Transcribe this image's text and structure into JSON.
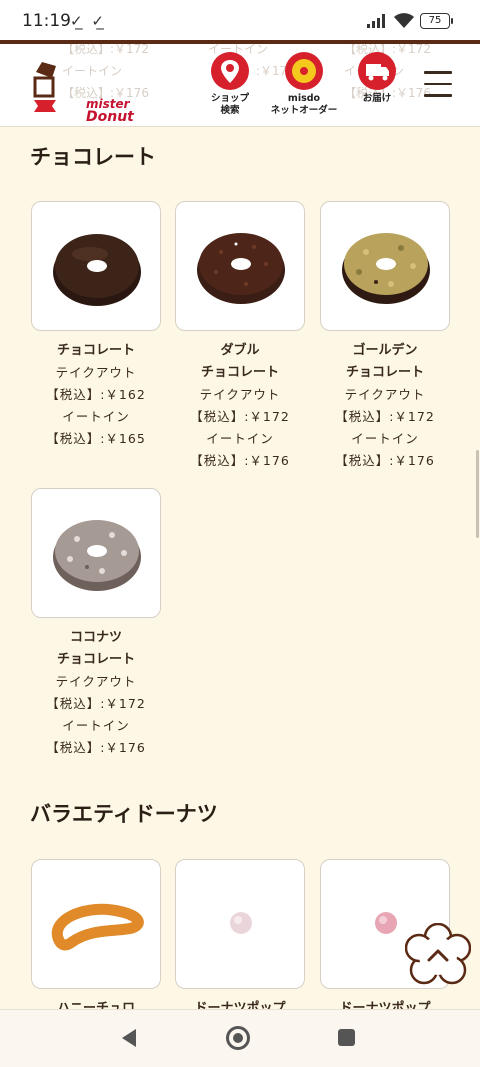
{
  "status_bar": {
    "time": "11:19",
    "check_marks": "✓̲ ✓̲",
    "battery": "75"
  },
  "header": {
    "logo_text": [
      "mister",
      "Donut"
    ],
    "ghost_left": [
      "【税込】:￥172",
      "イートイン",
      "【税込】:￥176"
    ],
    "ghost_mid": [
      "イートイン",
      "【税込】:￥176"
    ],
    "ghost_right": [
      "【税込】:￥172",
      "イートイン",
      "【税込】:￥176"
    ],
    "nav": [
      {
        "label": "ショップ\n検索",
        "icon": "location-pin-icon"
      },
      {
        "label": "misdo\nネットオーダー",
        "icon": "mobile-order-icon"
      },
      {
        "label": "お届け",
        "icon": "delivery-truck-icon"
      }
    ]
  },
  "sections": [
    {
      "title": "チョコレート",
      "items": [
        {
          "name_lines": [
            "チョコレート"
          ],
          "takeout_label": "テイクアウト",
          "takeout_price": "【税込】:￥162",
          "eatin_label": "イートイン",
          "eatin_price": "【税込】:￥165"
        },
        {
          "name_lines": [
            "ダブル",
            "チョコレート"
          ],
          "takeout_label": "テイクアウト",
          "takeout_price": "【税込】:￥172",
          "eatin_label": "イートイン",
          "eatin_price": "【税込】:￥176"
        },
        {
          "name_lines": [
            "ゴールデン",
            "チョコレート"
          ],
          "takeout_label": "テイクアウト",
          "takeout_price": "【税込】:￥172",
          "eatin_label": "イートイン",
          "eatin_price": "【税込】:￥176"
        },
        {
          "name_lines": [
            "ココナツ",
            "チョコレート"
          ],
          "takeout_label": "テイクアウト",
          "takeout_price": "【税込】:￥172",
          "eatin_label": "イートイン",
          "eatin_price": "【税込】:￥176"
        }
      ]
    },
    {
      "title": "バラエティドーナツ",
      "items": [
        {
          "name_lines": [
            "ハニーチュロ"
          ]
        },
        {
          "name_lines": [
            "ドーナツポップ"
          ]
        },
        {
          "name_lines": [
            "ドーナツポップ"
          ]
        }
      ]
    }
  ],
  "colors": {
    "accent_red": "#d6202c",
    "brown": "#5a2a14",
    "page_bg": "#fdf8e6"
  }
}
